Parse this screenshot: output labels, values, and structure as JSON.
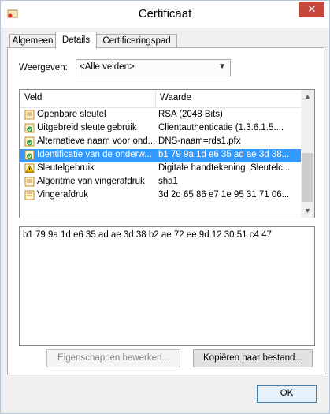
{
  "window": {
    "title": "Certificaat",
    "close_symbol": "✕"
  },
  "tabs": [
    {
      "label": "Algemeen",
      "active": false
    },
    {
      "label": "Details",
      "active": true
    },
    {
      "label": "Certificeringspad",
      "active": false
    }
  ],
  "show": {
    "label": "Weergeven:",
    "selected": "<Alle velden>"
  },
  "list": {
    "headers": {
      "field": "Veld",
      "value": "Waarde"
    },
    "rows": [
      {
        "icon": "certificate-field-icon",
        "field": "Openbare sleutel",
        "value": "RSA (2048 Bits)",
        "selected": false
      },
      {
        "icon": "certificate-extension-icon",
        "field": "Uitgebreid sleutelgebruik",
        "value": "Clientauthenticatie (1.3.6.1.5....",
        "selected": false
      },
      {
        "icon": "certificate-extension-icon",
        "field": "Alternatieve naam voor ond...",
        "value": "DNS-naam=rds1.pfx",
        "selected": false
      },
      {
        "icon": "certificate-extension-icon",
        "field": "Identificatie van de onderw...",
        "value": "b1 79 9a 1d e6 35 ad ae 3d 38...",
        "selected": true
      },
      {
        "icon": "warning-icon",
        "field": "Sleutelgebruik",
        "value": "Digitale handtekening, Sleutelc...",
        "selected": false
      },
      {
        "icon": "certificate-field-icon",
        "field": "Algoritme van vingerafdruk",
        "value": "sha1",
        "selected": false
      },
      {
        "icon": "certificate-field-icon",
        "field": "Vingerafdruk",
        "value": "3d 2d 65 86 e7 1e 95 31 71 06...",
        "selected": false
      }
    ]
  },
  "detail_value": "b1 79 9a 1d e6 35 ad ae 3d 38 b2 ae 72 ee 9d 12 30 51 c4 47",
  "buttons": {
    "edit_properties": "Eigenschappen bewerken...",
    "copy_to_file": "Kopiëren naar bestand...",
    "ok": "OK"
  },
  "colors": {
    "selection": "#3399ff",
    "close": "#c7463a"
  }
}
